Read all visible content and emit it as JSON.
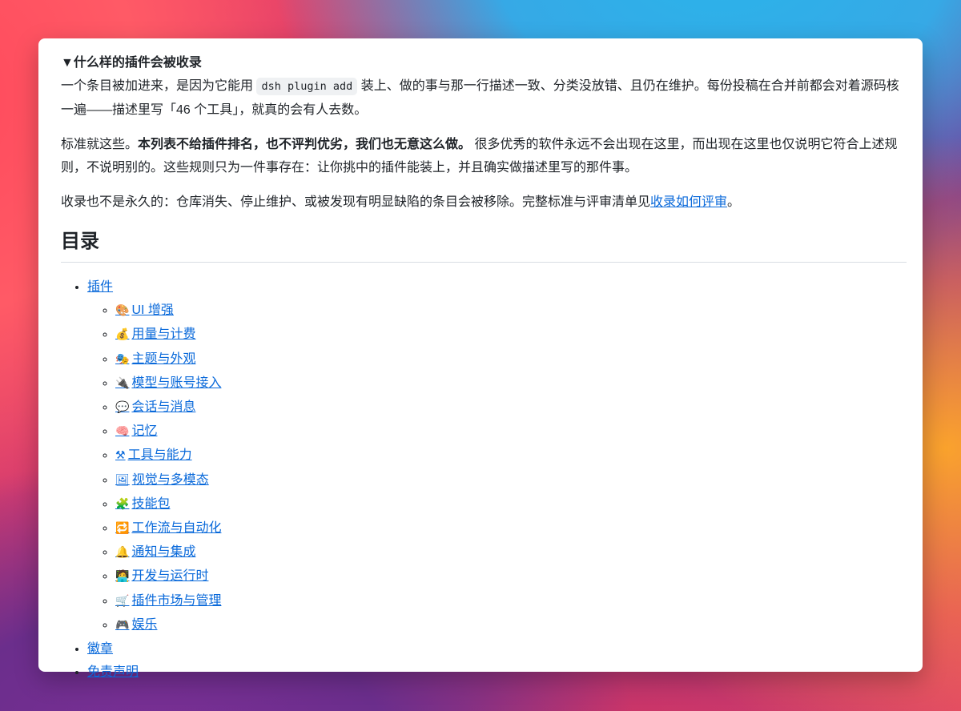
{
  "details": {
    "summary": "▼什么样的插件会被收录",
    "p1_text_before_code": "一个条目被加进来，是因为它能用 ",
    "p1_code": "dsh plugin add",
    "p1_text_after_code": " 装上、做的事与那一行描述一致、分类没放错、且仍在维护。每份投稿在合并前都会对着源码核一遍——描述里写「46 个工具」，就真的会有人去数。",
    "p2_text_before_bold": "标准就这些。",
    "p2_bold": "本列表不给插件排名，也不评判优劣，我们也无意这么做。",
    "p2_text_after_bold": " 很多优秀的软件永远不会出现在这里，而出现在这里也仅说明它符合上述规则，不说明别的。这些规则只为一件事存在：让你挑中的插件能装上，并且确实做描述里写的那件事。",
    "p3_text_before_link": "收录也不是永久的：仓库消失、停止维护、或被发现有明显缺陷的条目会被移除。完整标准与评审清单见",
    "p3_link": "收录如何评审",
    "p3_text_after_link": "。"
  },
  "toc": {
    "heading": "目录",
    "plugins_label": "插件",
    "categories": [
      {
        "emoji": "🎨",
        "icon": "palette-icon",
        "label": "UI 增强"
      },
      {
        "emoji": "💰",
        "icon": "money-bag-icon",
        "label": "用量与计费"
      },
      {
        "emoji": "🎭",
        "icon": "theater-masks-icon",
        "label": "主题与外观"
      },
      {
        "emoji": "🔌",
        "icon": "plug-icon",
        "label": "模型与账号接入"
      },
      {
        "emoji": "💬",
        "icon": "speech-bubble-icon",
        "label": "会话与消息"
      },
      {
        "emoji": "🧠",
        "icon": "brain-icon",
        "label": "记忆"
      },
      {
        "emoji": "⚒",
        "icon": "hammer-wrench-icon",
        "label": "工具与能力"
      },
      {
        "emoji": "🖼",
        "icon": "picture-icon",
        "label": "视觉与多模态"
      },
      {
        "emoji": "🧩",
        "icon": "puzzle-icon",
        "label": "技能包"
      },
      {
        "emoji": "🔁",
        "icon": "repeat-icon",
        "label": "工作流与自动化"
      },
      {
        "emoji": "🔔",
        "icon": "bell-icon",
        "label": "通知与集成"
      },
      {
        "emoji": "🧑‍💻",
        "icon": "technologist-icon",
        "label": "开发与运行时"
      },
      {
        "emoji": "🛒",
        "icon": "shopping-cart-icon",
        "label": "插件市场与管理"
      },
      {
        "emoji": "🎮",
        "icon": "game-controller-icon",
        "label": "娱乐"
      }
    ],
    "badges_label": "徽章",
    "disclaimer_label": "免责声明"
  }
}
